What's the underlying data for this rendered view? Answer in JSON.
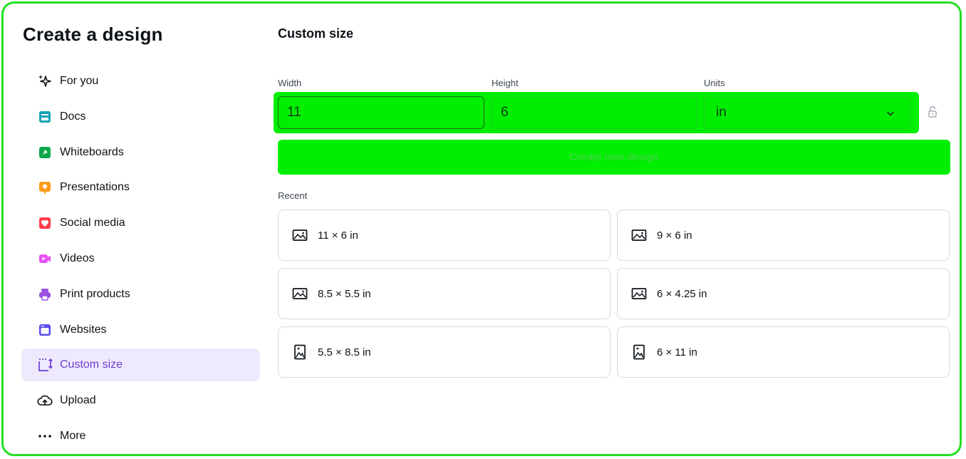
{
  "sidebar": {
    "title": "Create a design",
    "items": [
      {
        "label": "For you",
        "icon": "sparkle-icon",
        "color": "#0e1318"
      },
      {
        "label": "Docs",
        "icon": "docs-icon",
        "color": "#13a3b5"
      },
      {
        "label": "Whiteboards",
        "icon": "whiteboard-icon",
        "color": "#0ba84a"
      },
      {
        "label": "Presentations",
        "icon": "presentation-icon",
        "color": "#ff9b1a"
      },
      {
        "label": "Social media",
        "icon": "heart-icon",
        "color": "#ff3b4b"
      },
      {
        "label": "Videos",
        "icon": "video-icon",
        "color": "#e950f7"
      },
      {
        "label": "Print products",
        "icon": "printer-icon",
        "color": "#9b51e0"
      },
      {
        "label": "Websites",
        "icon": "website-icon",
        "color": "#5a4cf0"
      },
      {
        "label": "Custom size",
        "icon": "custom-size-icon",
        "color": "#6c3fd0",
        "active": true
      },
      {
        "label": "Upload",
        "icon": "upload-cloud-icon",
        "color": "#0e1318"
      },
      {
        "label": "More",
        "icon": "more-dots-icon",
        "color": "#0e1318"
      }
    ]
  },
  "main": {
    "title": "Custom size",
    "width_label": "Width",
    "height_label": "Height",
    "units_label": "Units",
    "width_value": "11",
    "height_value": "6",
    "units_value": "in",
    "create_button": "Create new design",
    "recent_label": "Recent",
    "recent": [
      {
        "label": "11 × 6 in",
        "icon": "landscape-image-icon"
      },
      {
        "label": "9 × 6 in",
        "icon": "landscape-image-icon"
      },
      {
        "label": "8.5 × 5.5 in",
        "icon": "landscape-image-icon"
      },
      {
        "label": "6 × 4.25 in",
        "icon": "landscape-image-icon"
      },
      {
        "label": "5.5 × 8.5 in",
        "icon": "portrait-image-icon"
      },
      {
        "label": "6 × 11 in",
        "icon": "portrait-image-icon"
      }
    ]
  },
  "colors": {
    "highlight": "#00ee00",
    "frame_border": "#22e022",
    "active_bg": "#efe9fd",
    "active_text": "#6c3fd0"
  }
}
